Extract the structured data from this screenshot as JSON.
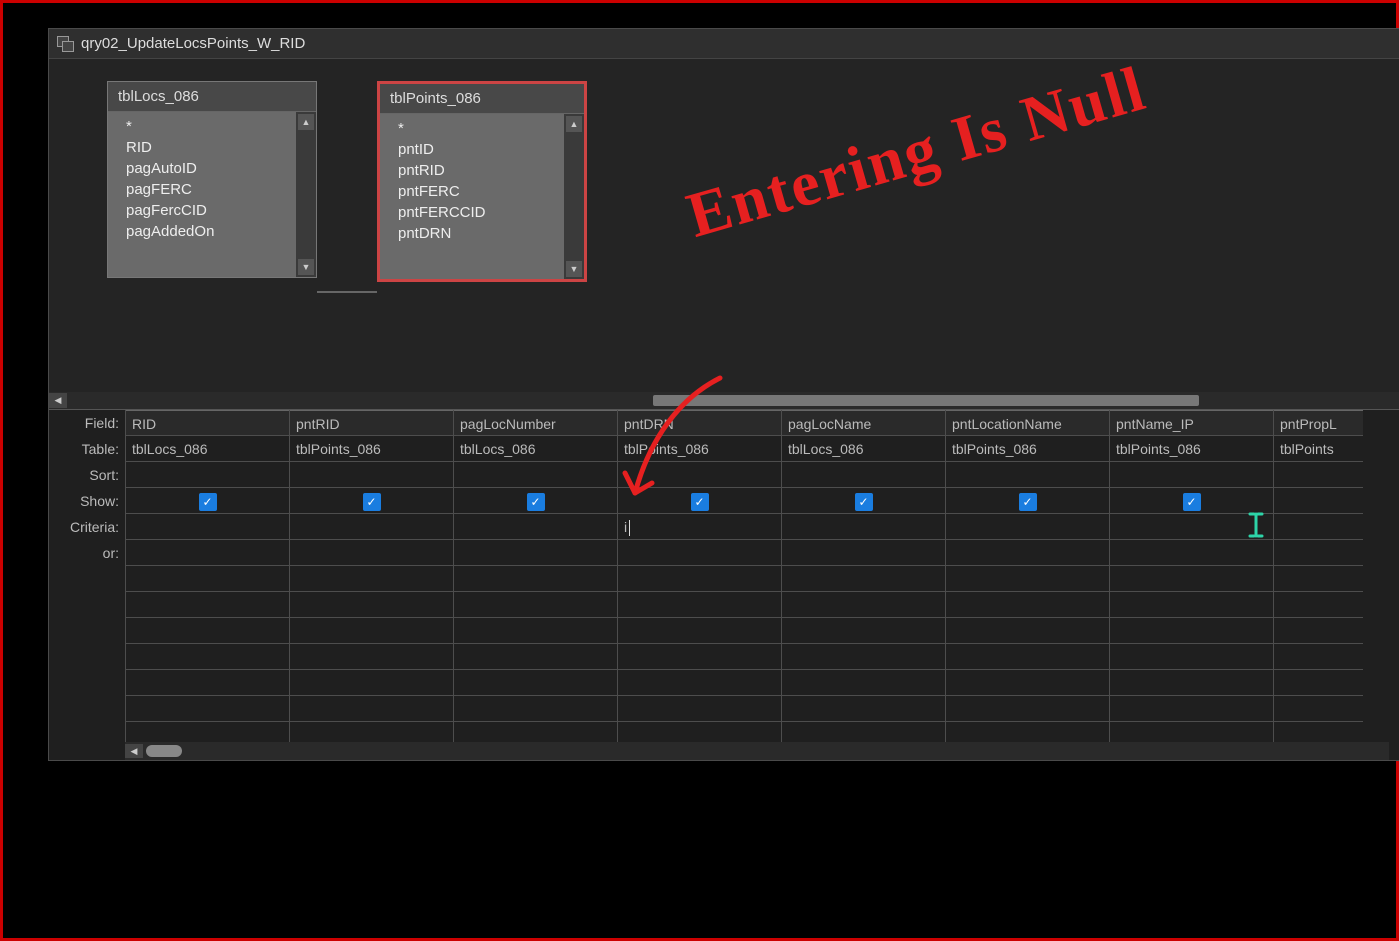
{
  "window": {
    "title": "qry02_UpdateLocsPoints_W_RID"
  },
  "tables": [
    {
      "name": "tblLocs_086",
      "fields": [
        "*",
        "RID",
        "pagAutoID",
        "pagFERC",
        "pagFercCID",
        "pagAddedOn"
      ]
    },
    {
      "name": "tblPoints_086",
      "fields": [
        "*",
        "pntID",
        "pntRID",
        "pntFERC",
        "pntFERCCID",
        "pntDRN"
      ]
    }
  ],
  "rowLabels": {
    "field": "Field:",
    "table": "Table:",
    "sort": "Sort:",
    "show": "Show:",
    "criteria": "Criteria:",
    "or": "or:"
  },
  "columns": [
    {
      "field": "RID",
      "table": "tblLocs_086",
      "show": true,
      "criteria": ""
    },
    {
      "field": "pntRID",
      "table": "tblPoints_086",
      "show": true,
      "criteria": ""
    },
    {
      "field": "pagLocNumber",
      "table": "tblLocs_086",
      "show": true,
      "criteria": ""
    },
    {
      "field": "pntDRN",
      "table": "tblPoints_086",
      "show": true,
      "criteria": "i"
    },
    {
      "field": "pagLocName",
      "table": "tblLocs_086",
      "show": true,
      "criteria": ""
    },
    {
      "field": "pntLocationName",
      "table": "tblPoints_086",
      "show": true,
      "criteria": ""
    },
    {
      "field": "pntName_IP",
      "table": "tblPoints_086",
      "show": true,
      "criteria": ""
    },
    {
      "field": "pntPropL",
      "table": "tblPoints",
      "show": false,
      "criteria": ""
    }
  ],
  "annotation": {
    "text": "Entering Is Null"
  }
}
